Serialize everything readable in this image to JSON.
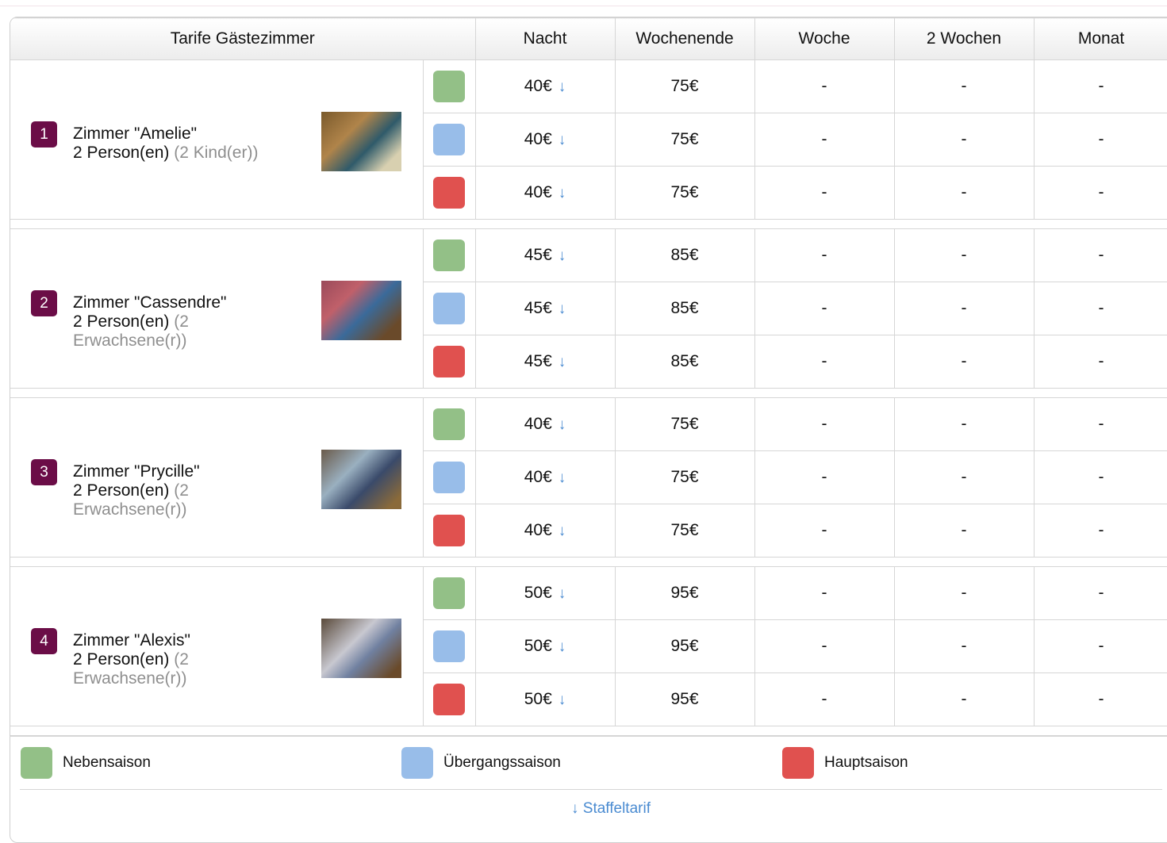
{
  "colors": {
    "Nebensaison": "#93c087",
    "Übergangssaison": "#98bde9",
    "Hauptsaison": "#e0514f",
    "badge": "#6b0d47",
    "link": "#4a8bd1"
  },
  "header": {
    "title": "Tarife Gästezimmer",
    "columns": [
      "Nacht",
      "Wochenende",
      "Woche",
      "2 Wochen",
      "Monat"
    ]
  },
  "arrow_symbol": "↓",
  "rooms": [
    {
      "number": "1",
      "name": "Zimmer \"Amelie\"",
      "persons": "2 Person(en)",
      "detail": "(2 Kind(er))",
      "rates": [
        {
          "season": "Nebensaison",
          "night": "40€",
          "weekend": "75€",
          "week": "-",
          "two_weeks": "-",
          "month": "-"
        },
        {
          "season": "Übergangssaison",
          "night": "40€",
          "weekend": "75€",
          "week": "-",
          "two_weeks": "-",
          "month": "-"
        },
        {
          "season": "Hauptsaison",
          "night": "40€",
          "weekend": "75€",
          "week": "-",
          "two_weeks": "-",
          "month": "-"
        }
      ]
    },
    {
      "number": "2",
      "name": "Zimmer \"Cassendre\"",
      "persons": "2 Person(en)",
      "detail": "(2 Erwachsene(r))",
      "rates": [
        {
          "season": "Nebensaison",
          "night": "45€",
          "weekend": "85€",
          "week": "-",
          "two_weeks": "-",
          "month": "-"
        },
        {
          "season": "Übergangssaison",
          "night": "45€",
          "weekend": "85€",
          "week": "-",
          "two_weeks": "-",
          "month": "-"
        },
        {
          "season": "Hauptsaison",
          "night": "45€",
          "weekend": "85€",
          "week": "-",
          "two_weeks": "-",
          "month": "-"
        }
      ]
    },
    {
      "number": "3",
      "name": "Zimmer \"Prycille\"",
      "persons": "2 Person(en)",
      "detail": "(2 Erwachsene(r))",
      "rates": [
        {
          "season": "Nebensaison",
          "night": "40€",
          "weekend": "75€",
          "week": "-",
          "two_weeks": "-",
          "month": "-"
        },
        {
          "season": "Übergangssaison",
          "night": "40€",
          "weekend": "75€",
          "week": "-",
          "two_weeks": "-",
          "month": "-"
        },
        {
          "season": "Hauptsaison",
          "night": "40€",
          "weekend": "75€",
          "week": "-",
          "two_weeks": "-",
          "month": "-"
        }
      ]
    },
    {
      "number": "4",
      "name": "Zimmer \"Alexis\"",
      "persons": "2 Person(en)",
      "detail": "(2 Erwachsene(r))",
      "rates": [
        {
          "season": "Nebensaison",
          "night": "50€",
          "weekend": "95€",
          "week": "-",
          "two_weeks": "-",
          "month": "-"
        },
        {
          "season": "Übergangssaison",
          "night": "50€",
          "weekend": "95€",
          "week": "-",
          "two_weeks": "-",
          "month": "-"
        },
        {
          "season": "Hauptsaison",
          "night": "50€",
          "weekend": "95€",
          "week": "-",
          "two_weeks": "-",
          "month": "-"
        }
      ]
    }
  ],
  "legend": [
    {
      "label": "Nebensaison"
    },
    {
      "label": "Übergangssaison"
    },
    {
      "label": "Hauptsaison"
    }
  ],
  "footnote": "↓ Staffeltarif"
}
